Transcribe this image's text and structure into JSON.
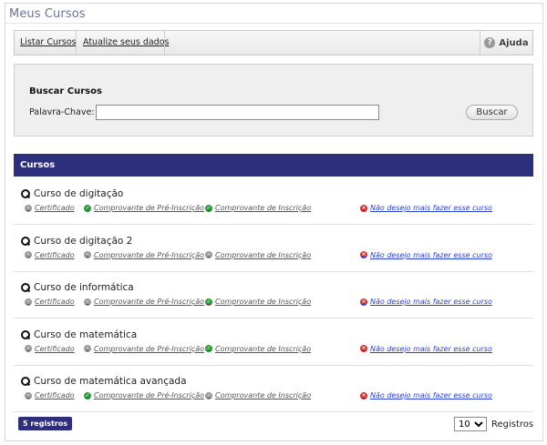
{
  "page_title": "Meus Cursos",
  "toolbar": {
    "links": [
      "Listar Cursos",
      "Atualize seus dados"
    ],
    "help_label": "Ajuda"
  },
  "search": {
    "title": "Buscar Cursos",
    "keyword_label": "Palavra-Chave:",
    "keyword_value": "",
    "button_label": "Buscar"
  },
  "courses": {
    "header": "Cursos",
    "items": [
      {
        "name": "Curso de digitação",
        "actions": [
          {
            "label": "Certificado",
            "status": "disabled"
          },
          {
            "label": "Comprovante de Pré-Inscrição",
            "status": "ok"
          },
          {
            "label": "Comprovante de Inscrição",
            "status": "ok"
          },
          {
            "label": "Não desejo mais fazer esse curso",
            "status": "cancel"
          }
        ]
      },
      {
        "name": "Curso de digitação 2",
        "actions": [
          {
            "label": "Certificado",
            "status": "disabled"
          },
          {
            "label": "Comprovante de Pré-Inscrição",
            "status": "disabled"
          },
          {
            "label": "Comprovante de Inscrição",
            "status": "disabled"
          },
          {
            "label": "Não desejo mais fazer esse curso",
            "status": "cancel"
          }
        ]
      },
      {
        "name": "Curso de informática",
        "actions": [
          {
            "label": "Certificado",
            "status": "disabled"
          },
          {
            "label": "Comprovante de Pré-Inscrição",
            "status": "disabled"
          },
          {
            "label": "Comprovante de Inscrição",
            "status": "ok"
          },
          {
            "label": "Não desejo mais fazer esse curso",
            "status": "cancel"
          }
        ]
      },
      {
        "name": "Curso de matemática",
        "actions": [
          {
            "label": "Certificado",
            "status": "disabled"
          },
          {
            "label": "Comprovante de Pré-Inscrição",
            "status": "disabled"
          },
          {
            "label": "Comprovante de Inscrição",
            "status": "ok"
          },
          {
            "label": "Não desejo mais fazer esse curso",
            "status": "cancel"
          }
        ]
      },
      {
        "name": "Curso de matemática avançada",
        "actions": [
          {
            "label": "Certificado",
            "status": "disabled"
          },
          {
            "label": "Comprovante de Pré-Inscrição",
            "status": "ok"
          },
          {
            "label": "Comprovante de Inscrição",
            "status": "disabled"
          },
          {
            "label": "Não desejo mais fazer esse curso",
            "status": "cancel"
          }
        ]
      }
    ]
  },
  "pagination": {
    "count_label": "5 registros",
    "per_page_value": "10",
    "per_page_label": "Registros"
  },
  "colors": {
    "header_bg": "#2d2e7c",
    "ok": "#2e9c3a",
    "cancel": "#d83030",
    "disabled": "#9a9a9a",
    "link_blue": "#2a3fd6"
  }
}
